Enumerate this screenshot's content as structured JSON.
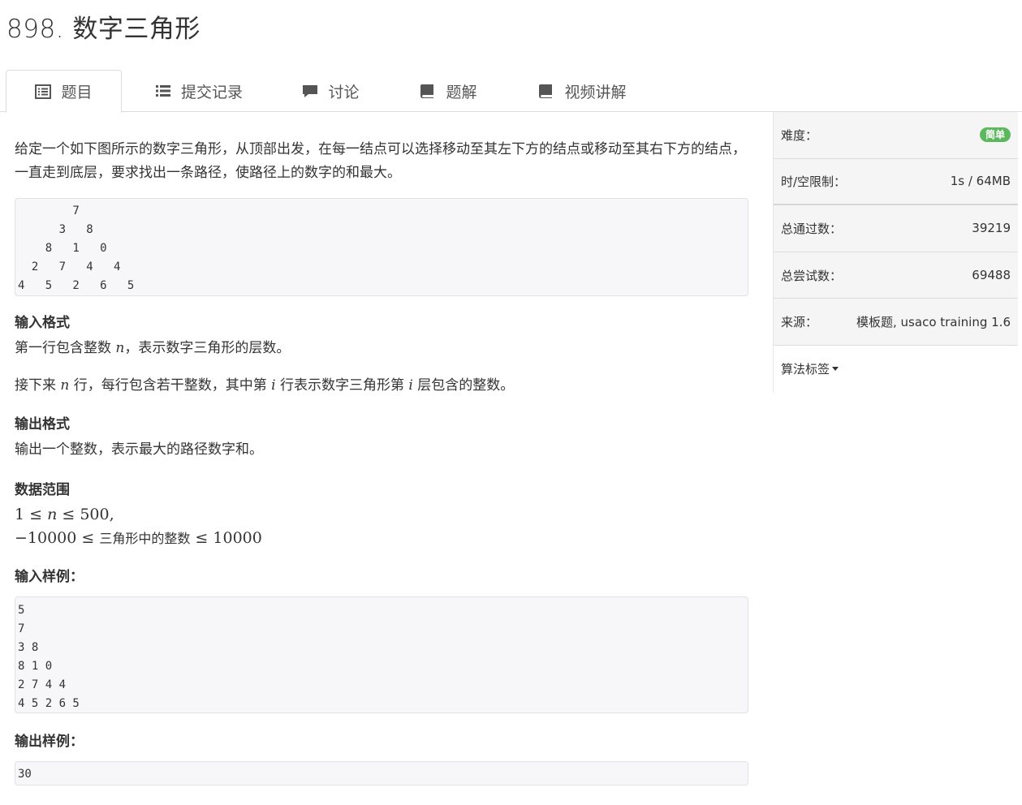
{
  "page": {
    "title": "898. 数字三角形"
  },
  "tabs": [
    {
      "label": "题目",
      "icon": "list-alt-icon"
    },
    {
      "label": "提交记录",
      "icon": "list-icon"
    },
    {
      "label": "讨论",
      "icon": "comment-icon"
    },
    {
      "label": "题解",
      "icon": "book-icon"
    },
    {
      "label": "视频讲解",
      "icon": "book-icon"
    }
  ],
  "problem": {
    "description": "给定一个如下图所示的数字三角形，从顶部出发，在每一结点可以选择移动至其左下方的结点或移动至其右下方的结点，一直走到底层，要求找出一条路径，使路径上的数字的和最大。",
    "triangle": "        7\n      3   8\n    8   1   0\n  2   7   4   4\n4   5   2   6   5",
    "input_format_heading": "输入格式",
    "input_format_1a": "第一行包含整数 ",
    "input_format_1var": "n",
    "input_format_1b": "，表示数字三角形的层数。",
    "input_format_2a": "接下来 ",
    "input_format_2var": "n",
    "input_format_2b": " 行，每行包含若干整数，其中第 ",
    "input_format_2var2": "i",
    "input_format_2c": " 行表示数字三角形第 ",
    "input_format_2var3": "i",
    "input_format_2d": " 层包含的整数。",
    "output_format_heading": "输出格式",
    "output_format": "输出一个整数，表示最大的路径数字和。",
    "range_heading": "数据范围",
    "range_1a": "1 ≤ ",
    "range_1var": "n",
    "range_1b": " ≤ 500,",
    "range_2a": "−10000 ≤ ",
    "range_2text": "三角形中的整数",
    "range_2b": " ≤ 10000",
    "sample_input_heading": "输入样例：",
    "sample_input": "5\n7\n3 8\n8 1 0\n2 7 4 4\n4 5 2 6 5",
    "sample_output_heading": "输出样例：",
    "sample_output": "30"
  },
  "sidebar": {
    "difficulty_label": "难度：",
    "difficulty_value": "简单",
    "limit_label": "时/空限制：",
    "limit_value": "1s / 64MB",
    "passed_label": "总通过数：",
    "passed_value": "39219",
    "attempts_label": "总尝试数：",
    "attempts_value": "69488",
    "source_label": "来源：",
    "source_value": "模板题, usaco training 1.6",
    "tags_label": "算法标签"
  },
  "colors": {
    "badge_green": "#5cb85c",
    "sidebar_bg": "#f5f5f5",
    "code_bg": "#f7f7f9"
  }
}
